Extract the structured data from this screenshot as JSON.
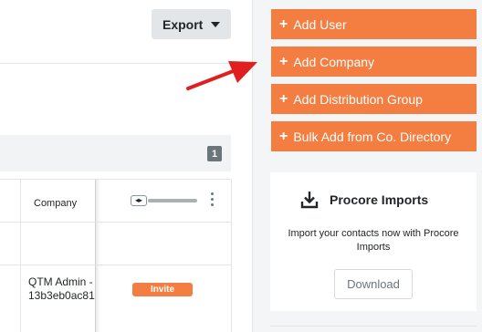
{
  "toolbar": {
    "export_label": "Export"
  },
  "pagination": {
    "page": "1"
  },
  "table": {
    "columns": [
      "Company"
    ],
    "rows": [
      {
        "company_line1": "QTM Admin -",
        "company_line2": "13b3eb0ac81",
        "action": "Invite"
      }
    ]
  },
  "actions": {
    "items": [
      {
        "label": "Add User"
      },
      {
        "label": "Add Company"
      },
      {
        "label": "Add Distribution Group"
      },
      {
        "label": "Bulk Add from Co. Directory"
      }
    ]
  },
  "imports": {
    "title": "Procore Imports",
    "description": "Import your contacts now with Procore Imports",
    "download_label": "Download"
  },
  "colors": {
    "accent": "#f47e42",
    "annotation_arrow": "#e02020",
    "panel_bg": "#f4f5f6",
    "button_gray": "#e3e6e8"
  },
  "icons": {
    "export_caret": "caret-down-icon",
    "action_plus": "plus-icon",
    "imports": "download-tray-icon",
    "column_menu": "kebab-icon",
    "column_resize": "resize-handle-icon",
    "annotation": "red-arrow-icon"
  }
}
